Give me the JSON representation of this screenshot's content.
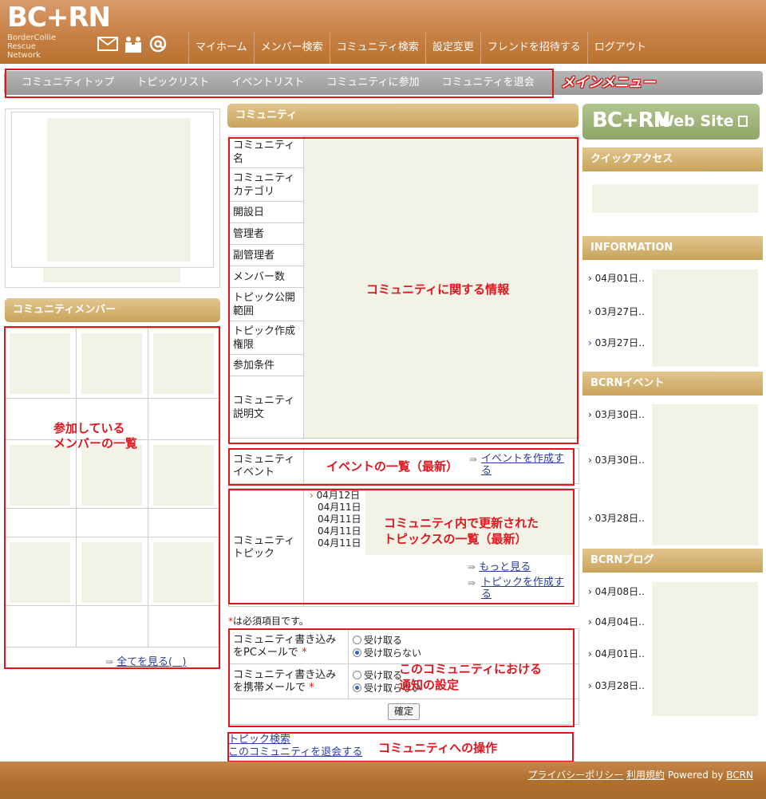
{
  "header": {
    "logo_text": "BC+RN",
    "logo_sub": [
      "BorderCollie",
      "Rescue",
      "Network"
    ],
    "nav": [
      "マイホーム",
      "メンバー検索",
      "コミュニティ検索",
      "設定変更",
      "フレンドを招待する",
      "ログアウト"
    ],
    "icons": [
      "mail-icon",
      "people-icon",
      "at-icon"
    ]
  },
  "mainmenu": {
    "items": [
      "コミュニティトップ",
      "トピックリスト",
      "イベントリスト",
      "コミュニティに参加",
      "コミュニティを退会"
    ],
    "annotation": "メインメニュー"
  },
  "left": {
    "members_title": "コミュニティメンバー",
    "members_annotation": [
      "参加している",
      "メンバーの一覧"
    ],
    "see_all": "全てを見る(",
    "see_all_close": ")"
  },
  "center": {
    "title": "コミュニティ",
    "info_rows": [
      {
        "label": "コミュニティ名"
      },
      {
        "label": "コミュニティカテゴリ"
      },
      {
        "label": "開設日"
      },
      {
        "label": "管理者"
      },
      {
        "label": "副管理者"
      },
      {
        "label": "メンバー数"
      },
      {
        "label": "トピック公開範囲"
      },
      {
        "label": "トピック作成権限"
      },
      {
        "label": "参加条件"
      },
      {
        "label": "コミュニティ説明文"
      }
    ],
    "info_annotation": "コミュニティに関する情報",
    "event_label": "コミュニティイベント",
    "event_annotation": "イベントの一覧（最新）",
    "event_create": "イベントを作成する",
    "topic_label": "コミュニティトピック",
    "topic_dates": [
      "04月12日",
      "04月11日",
      "04月11日",
      "04月11日",
      "04月11日"
    ],
    "topic_annotation": [
      "コミュニティ内で更新された",
      "トピックスの一覧（最新）"
    ],
    "more": "もっと見る",
    "topic_create": "トピックを作成する",
    "required_note": "は必須項目です。",
    "notif_rows": [
      {
        "label": "コミュニティ書き込みをPCメールで",
        "opt_yes": "受け取る",
        "opt_no": "受け取らない"
      },
      {
        "label": "コミュニティ書き込みを携帯メールで",
        "opt_yes": "受け取る",
        "opt_no": "受け取らない"
      }
    ],
    "notif_annotation": [
      "このコミュニティにおける",
      "通知の設定"
    ],
    "confirm": "確定",
    "ops": [
      "トピック検索",
      "このコミュニティを退会する"
    ],
    "ops_annotation": "コミュニティへの操作"
  },
  "right": {
    "website_logo": "BC+RN",
    "website_label": "Web Site",
    "quick_access": "クイックアクセス",
    "information_title": "INFORMATION",
    "information_dates": [
      "04月01日",
      "03月27日",
      "03月27日"
    ],
    "events_title": "BCRNイベント",
    "events_dates": [
      "03月30日",
      "03月30日",
      "03月28日"
    ],
    "blog_title": "BCRNブログ",
    "blog_dates": [
      "04月08日",
      "04月04日",
      "04月01日",
      "03月28日"
    ]
  },
  "footer": {
    "privacy": "プライバシーポリシー",
    "terms": "利用規約",
    "powered": "Powered by",
    "brand": "BCRN"
  },
  "colors": {
    "header": "#c57f43",
    "annotation_red": "#e0161e",
    "placeholder": "#f3f2e6",
    "gold_bar": "#c8a35b",
    "link": "#2a3c9c"
  }
}
